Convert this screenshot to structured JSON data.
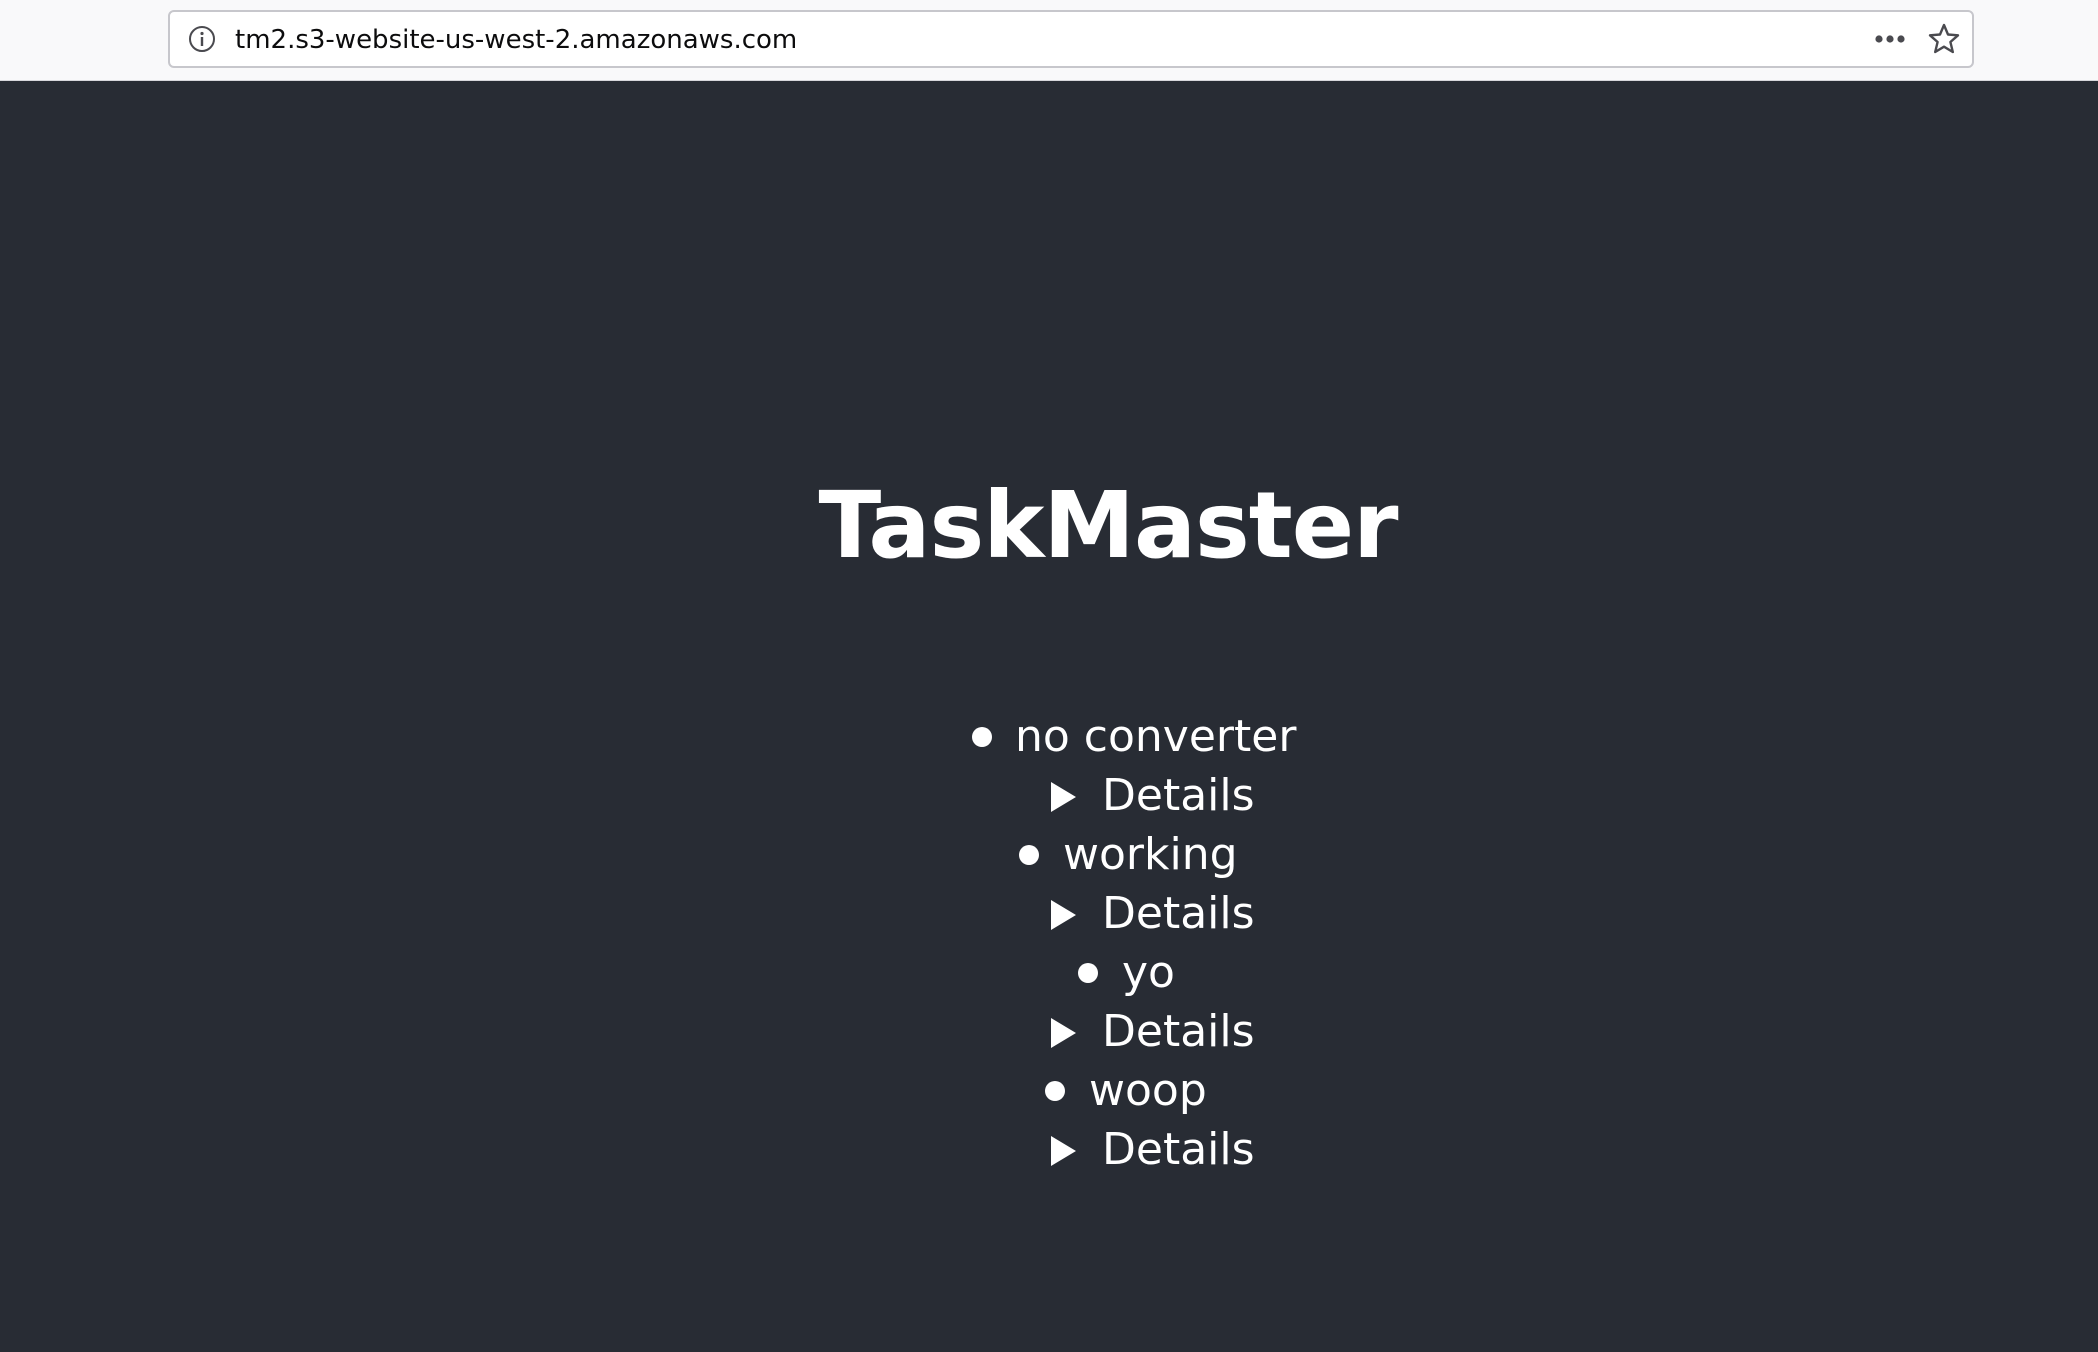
{
  "browser": {
    "url": "tm2.s3-website-us-west-2.amazonaws.com"
  },
  "app": {
    "title": "TaskMaster"
  },
  "tasks": [
    {
      "name": "no converter",
      "details_label": "Details"
    },
    {
      "name": "working",
      "details_label": "Details"
    },
    {
      "name": "yo",
      "details_label": "Details"
    },
    {
      "name": "woop",
      "details_label": "Details"
    }
  ],
  "colors": {
    "background": "#282c34",
    "text": "#ffffff",
    "chrome": "#f9f9fa"
  },
  "icons": [
    "info-icon",
    "more-options-icon",
    "bookmark-star-icon",
    "bullet-icon",
    "disclosure-triangle-icon"
  ]
}
